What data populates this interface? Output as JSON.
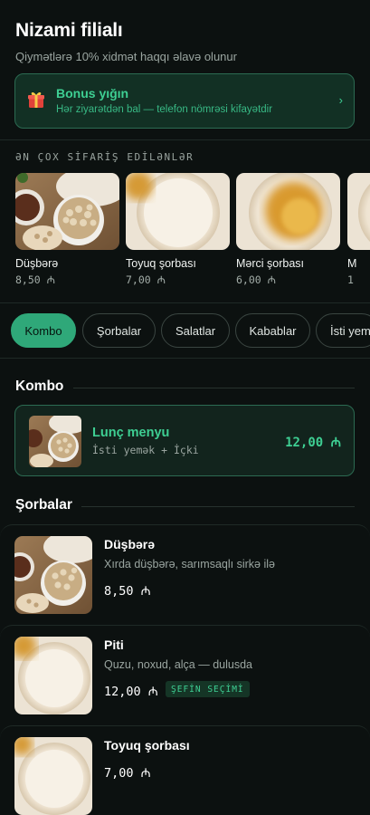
{
  "header": {
    "title": "Nizami filialı",
    "subtitle": "Qiymətlərə 10% xidmət haqqı əlavə olunur"
  },
  "bonus": {
    "icon": "gift-icon",
    "title": "Bonus yığın",
    "text": "Hər ziyarətdən bal — telefon nömrəsi kifayətdir",
    "chevron": "›"
  },
  "popular": {
    "caption": "ƏN ÇOX SİFARİŞ EDİLƏNLƏR",
    "items": [
      {
        "name": "Düşbərə",
        "price": "8,50 ₼"
      },
      {
        "name": "Toyuq şorbası",
        "price": "7,00 ₼"
      },
      {
        "name": "Mərci şorbası",
        "price": "6,00 ₼"
      },
      {
        "name": "M",
        "price": "1"
      }
    ]
  },
  "categories": [
    {
      "label": "Kombo",
      "active": true
    },
    {
      "label": "Şorbalar",
      "active": false
    },
    {
      "label": "Salatlar",
      "active": false
    },
    {
      "label": "Kabablar",
      "active": false
    },
    {
      "label": "İsti yem",
      "active": false
    }
  ],
  "sections": {
    "kombo": {
      "title": "Kombo",
      "items": [
        {
          "name": "Lunç menyu",
          "description": "İsti yemək + İçki",
          "price": "12,00 ₼"
        }
      ]
    },
    "sorbalar": {
      "title": "Şorbalar",
      "items": [
        {
          "name": "Düşbərə",
          "description": "Xırda düşbərə, sarımsaqlı sirkə ilə",
          "price": "8,50 ₼",
          "badge": ""
        },
        {
          "name": "Piti",
          "description": "Quzu, noxud, alça — dulusda",
          "price": "12,00 ₼",
          "badge": "ŞEFİN SEÇİMİ"
        },
        {
          "name": "Toyuq şorbası",
          "description": "",
          "price": "7,00 ₼",
          "badge": ""
        }
      ]
    }
  },
  "colors": {
    "background": "#0c1110",
    "accent": "#3ecf93",
    "accent_dark": "#2fa879",
    "card_bg": "#12241d",
    "muted_text": "#9aa5a0"
  }
}
